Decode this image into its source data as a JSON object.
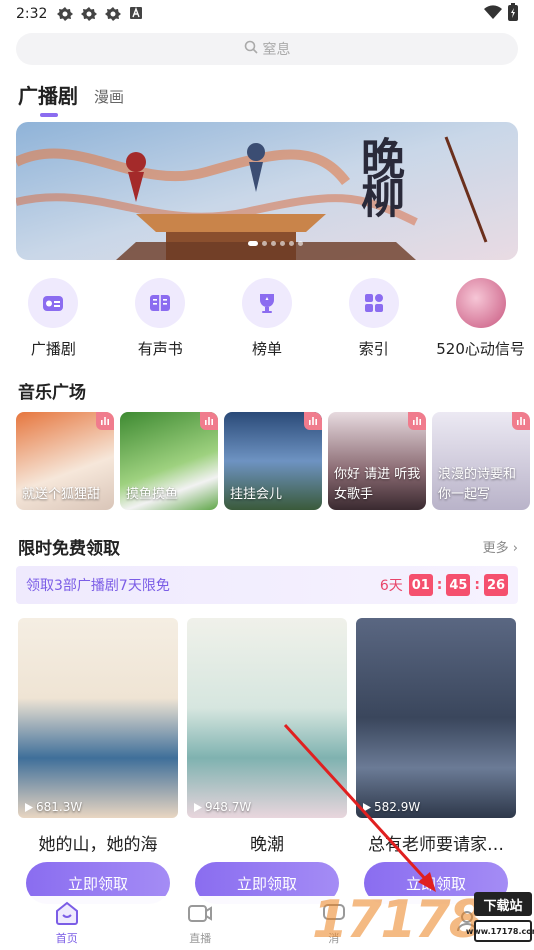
{
  "status_bar": {
    "time": "2:32",
    "icons": [
      "settings-gear-icon",
      "settings-gear-icon",
      "settings-gear-icon",
      "font-a-icon"
    ],
    "right_icons": [
      "wifi-icon",
      "battery-icon"
    ]
  },
  "search": {
    "placeholder": "窒息",
    "icon": "search-icon"
  },
  "tabs": [
    {
      "label": "广播剧",
      "active": true
    },
    {
      "label": "漫画",
      "active": false
    }
  ],
  "banner": {
    "title_art": "晚柳",
    "dots": 6,
    "active_dot": 0
  },
  "quick_links": [
    {
      "label": "广播剧",
      "icon": "radio-icon"
    },
    {
      "label": "有声书",
      "icon": "book-icon"
    },
    {
      "label": "榜单",
      "icon": "trophy-icon"
    },
    {
      "label": "索引",
      "icon": "index-grid-icon"
    },
    {
      "label": "520心动信号",
      "icon": "heart-signal-avatar"
    }
  ],
  "music_section": {
    "title": "音乐广场"
  },
  "music_cards": [
    {
      "label": "就送个狐狸甜",
      "sub": "",
      "colors": [
        "#c95a3a",
        "#f3e6dc"
      ]
    },
    {
      "label": "摸鱼摸鱼",
      "sub": "",
      "colors": [
        "#4a9a3a",
        "#b8e0a0"
      ]
    },
    {
      "label": "挂挂会儿",
      "sub": "",
      "colors": [
        "#2f4d78",
        "#9bb7d6"
      ]
    },
    {
      "label": "女歌手",
      "sub": "你好 请进 听我",
      "colors": [
        "#5a4a52",
        "#d9c8cf"
      ]
    },
    {
      "label": "你一起写",
      "sub": "浪漫的诗要和",
      "colors": [
        "#b9b3c9",
        "#ece9f3"
      ]
    }
  ],
  "free_section": {
    "title": "限时免费领取",
    "more": "更多"
  },
  "promo": {
    "text": "领取3部广播剧7天限免",
    "days": "6天",
    "h": "01",
    "m": "45",
    "s": "26"
  },
  "dramas": [
    {
      "title": "她的山，她的海",
      "plays": "681.3W",
      "claim": "立即领取",
      "colors": [
        "#f4ece0",
        "#e7d8c5"
      ]
    },
    {
      "title": "晚潮",
      "plays": "948.7W",
      "claim": "立即领取",
      "colors": [
        "#e9f0ea",
        "#c6d9d2"
      ]
    },
    {
      "title": "总有老师要请家…",
      "plays": "582.9W",
      "claim": "立即领取",
      "colors": [
        "#3d4a63",
        "#8b9bb5"
      ]
    }
  ],
  "bottom_nav": [
    {
      "label": "首页",
      "icon": "home-icon",
      "active": true
    },
    {
      "label": "直播",
      "icon": "live-tv-icon",
      "active": false
    },
    {
      "label": "消",
      "icon": "message-icon",
      "active": false
    },
    {
      "label": "",
      "icon": "profile-icon",
      "active": false
    }
  ],
  "watermark": {
    "number": "17178",
    "badge_top": "下载站",
    "badge_bottom": "www.17178.com"
  },
  "colors": {
    "accent": "#8b6cf0",
    "countdown": "#f5506e",
    "arrow": "#e02020"
  }
}
